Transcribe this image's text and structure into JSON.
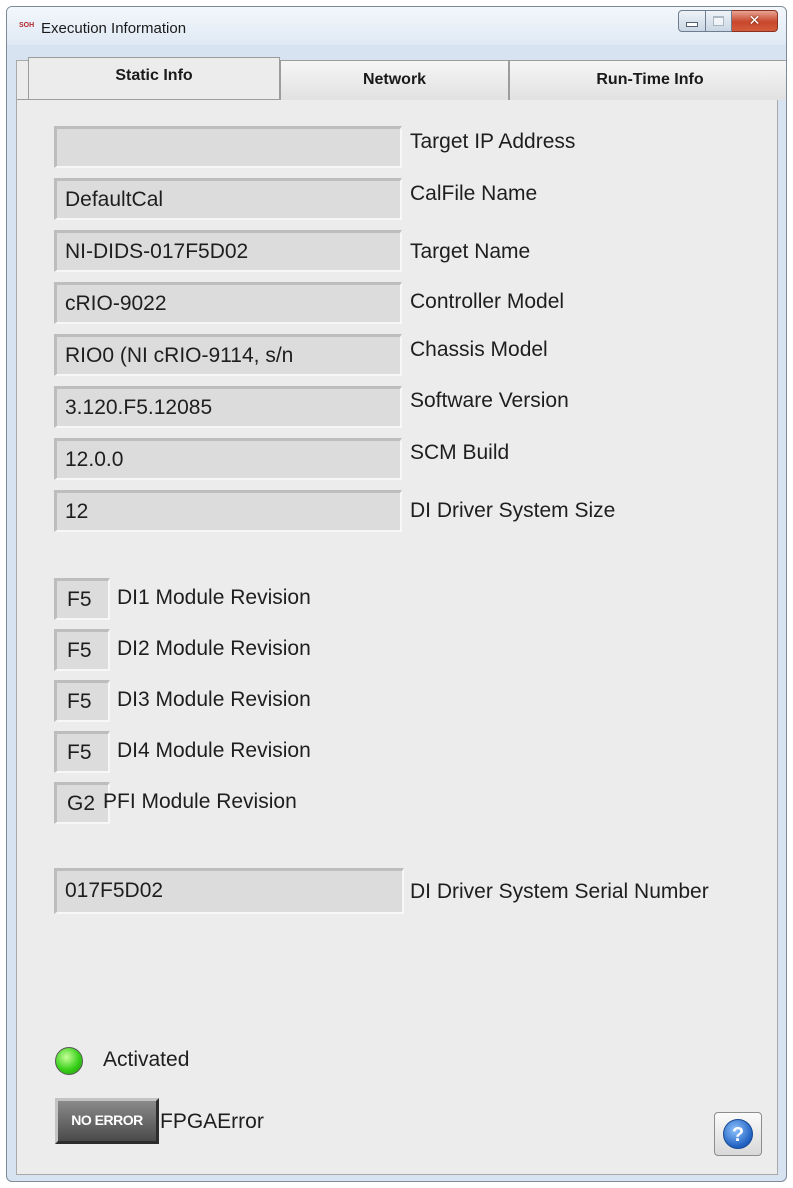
{
  "window": {
    "title": "Execution Information",
    "app_icon": "SOH",
    "controls": {
      "minimize": "minimize-icon",
      "maximize": "maximize-icon",
      "close": "✕"
    }
  },
  "tabs": [
    {
      "label": "Static Info",
      "active": true
    },
    {
      "label": "Network",
      "active": false
    },
    {
      "label": "Run-Time Info",
      "active": false
    }
  ],
  "static_info": {
    "target_ip": {
      "value": "",
      "label": "Target IP Address"
    },
    "calfile": {
      "value": "DefaultCal",
      "label": "CalFile Name"
    },
    "target_name": {
      "value": "NI-DIDS-017F5D02",
      "label": "Target Name"
    },
    "controller_model": {
      "value": "cRIO-9022",
      "label": "Controller Model"
    },
    "chassis_model": {
      "value": "RIO0 (NI cRIO-9114, s/n",
      "label": "Chassis Model"
    },
    "software_version": {
      "value": "3.120.F5.12085",
      "label": "Software Version"
    },
    "scm_build": {
      "value": "12.0.0",
      "label": "SCM Build"
    },
    "system_size": {
      "value": "12",
      "label": "DI Driver System Size"
    },
    "modules": [
      {
        "value": "F5",
        "label": "DI1 Module Revision"
      },
      {
        "value": "F5",
        "label": "DI2 Module Revision"
      },
      {
        "value": "F5",
        "label": "DI3 Module Revision"
      },
      {
        "value": "F5",
        "label": "DI4 Module Revision"
      },
      {
        "value": "G2",
        "label": "PFI Module Revision"
      }
    ],
    "serial": {
      "value": "017F5D02",
      "label": "DI Driver System Serial Number"
    },
    "activated": {
      "label": "Activated",
      "led_color": "#39d11a"
    },
    "fpga_error": {
      "value": "NO ERROR",
      "label": "FPGAError"
    }
  },
  "help_button": {
    "icon": "?"
  }
}
